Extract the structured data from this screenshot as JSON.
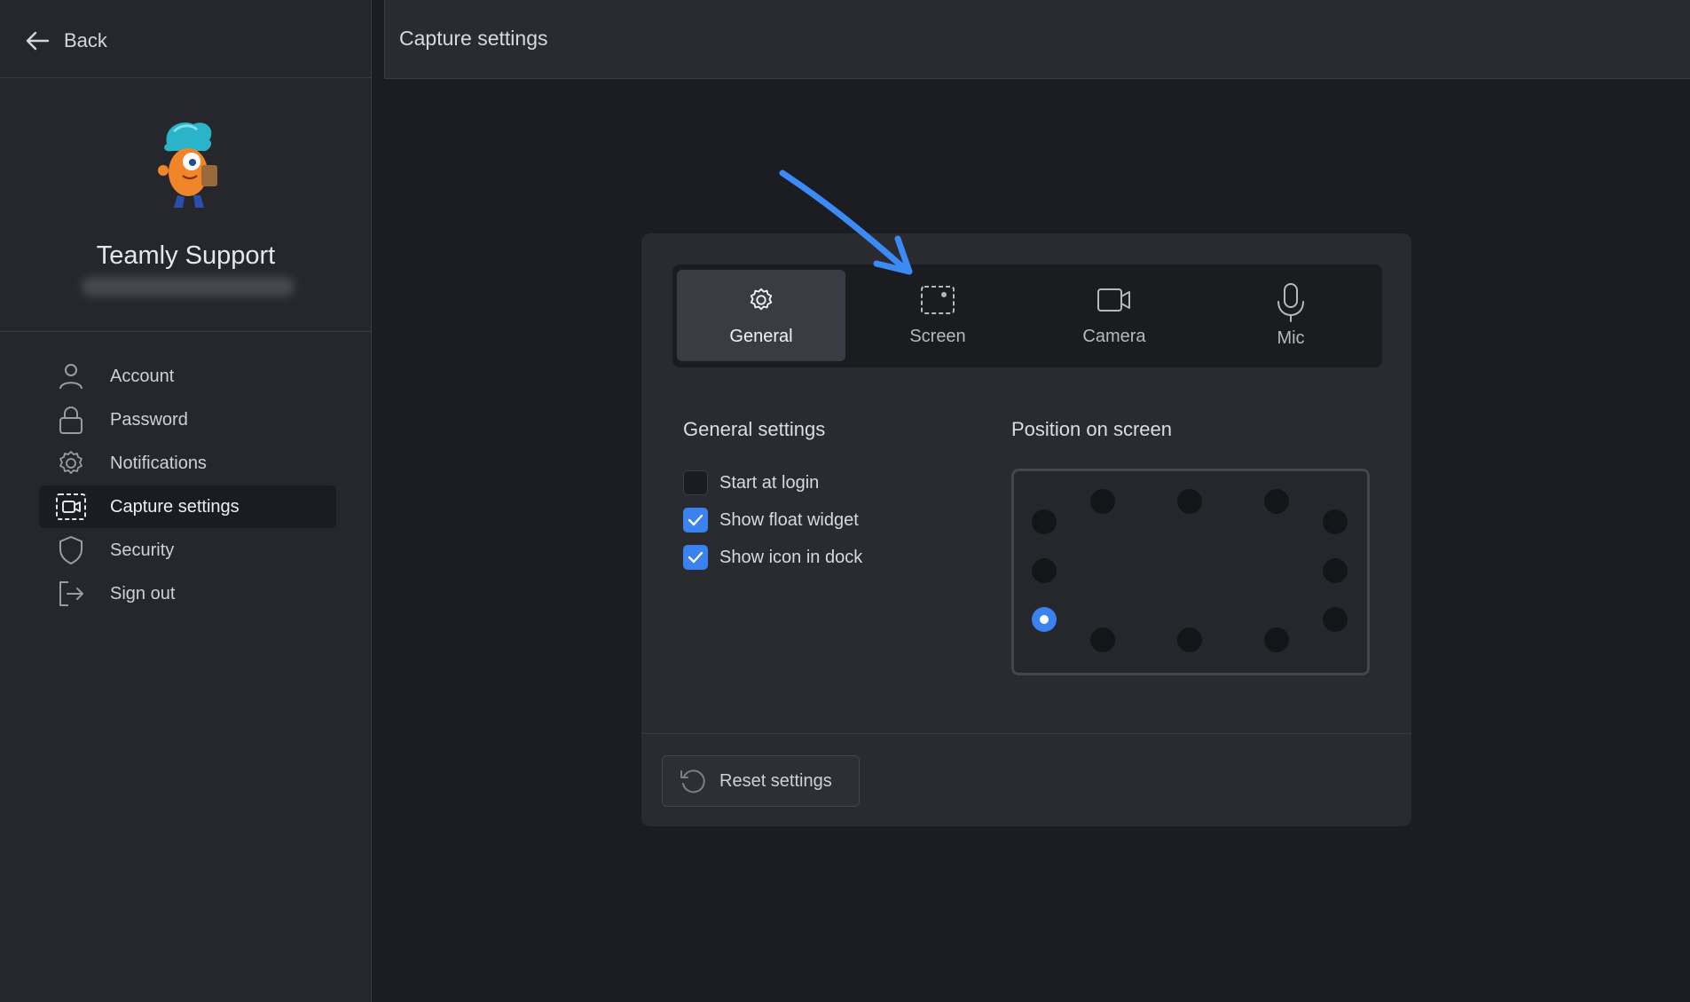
{
  "sidebar": {
    "back_label": "Back",
    "profile": {
      "name": "Teamly Support"
    },
    "menu": [
      {
        "label": "Account",
        "icon": "user-icon",
        "active": false
      },
      {
        "label": "Password",
        "icon": "lock-icon",
        "active": false
      },
      {
        "label": "Notifications",
        "icon": "gear-icon",
        "active": false
      },
      {
        "label": "Capture settings",
        "icon": "capture-icon",
        "active": true
      },
      {
        "label": "Security",
        "icon": "shield-icon",
        "active": false
      },
      {
        "label": "Sign out",
        "icon": "sign-out-icon",
        "active": false
      }
    ]
  },
  "topbar": {
    "title": "Capture settings"
  },
  "tabs": [
    {
      "label": "General",
      "icon": "gear-icon",
      "active": true
    },
    {
      "label": "Screen",
      "icon": "screen-select-icon",
      "active": false
    },
    {
      "label": "Camera",
      "icon": "camera-icon",
      "active": false
    },
    {
      "label": "Mic",
      "icon": "microphone-icon",
      "active": false
    }
  ],
  "general_settings": {
    "title": "General settings",
    "options": [
      {
        "label": "Start at login",
        "checked": false
      },
      {
        "label": "Show float widget",
        "checked": true
      },
      {
        "label": "Show icon in dock",
        "checked": true
      }
    ]
  },
  "position": {
    "title": "Position on screen",
    "selected": "left-bottom"
  },
  "reset_label": "Reset settings",
  "colors": {
    "accent": "#3a82f0",
    "annotation_arrow": "#3b8af5",
    "background": "#1c1d22",
    "panel": "#2a2b31"
  }
}
